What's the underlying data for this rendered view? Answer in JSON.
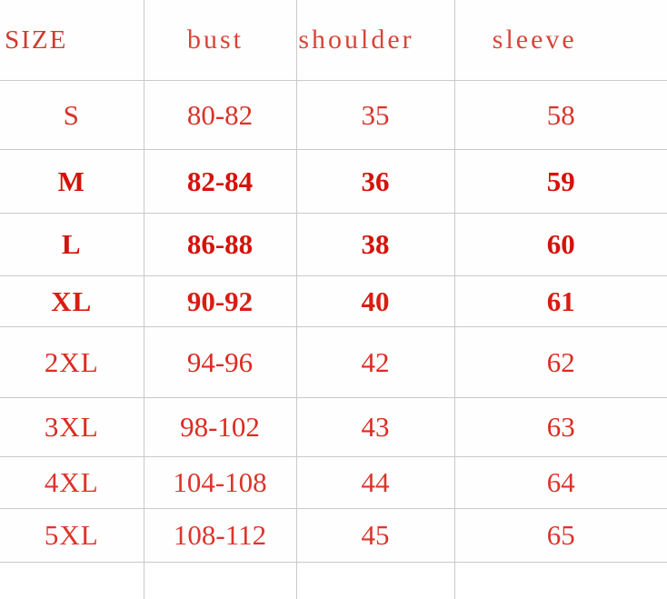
{
  "table": {
    "columns": [
      {
        "key": "size",
        "label": "SIZE"
      },
      {
        "key": "bust",
        "label": "bust"
      },
      {
        "key": "shoulder",
        "label": "shoulder"
      },
      {
        "key": "sleeve",
        "label": "sleeve"
      }
    ],
    "rows": [
      {
        "size": "S",
        "bust": "80-82",
        "shoulder": "35",
        "sleeve": "58"
      },
      {
        "size": "M",
        "bust": "82-84",
        "shoulder": "36",
        "sleeve": "59"
      },
      {
        "size": "L",
        "bust": "86-88",
        "shoulder": "38",
        "sleeve": "60"
      },
      {
        "size": "XL",
        "bust": "90-92",
        "shoulder": "40",
        "sleeve": "61"
      },
      {
        "size": "2XL",
        "bust": "94-96",
        "shoulder": "42",
        "sleeve": "62"
      },
      {
        "size": "3XL",
        "bust": "98-102",
        "shoulder": "43",
        "sleeve": "63"
      },
      {
        "size": "4XL",
        "bust": "104-108",
        "shoulder": "44",
        "sleeve": "64"
      },
      {
        "size": "5XL",
        "bust": "108-112",
        "shoulder": "45",
        "sleeve": "65"
      }
    ]
  },
  "style": {
    "text_color": "#d81f15",
    "header_color": "#d94438",
    "grid_color": "#c9c9c9",
    "background": "#fefefe"
  }
}
